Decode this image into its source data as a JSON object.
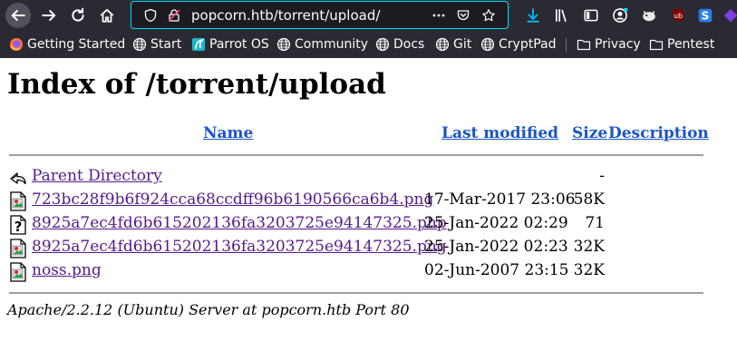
{
  "browser": {
    "url": "popcorn.htb/torrent/upload/",
    "bookmarks": [
      {
        "label": "Getting Started",
        "icon": "firefox-icon"
      },
      {
        "label": "Start",
        "icon": "globe-icon"
      },
      {
        "label": "Parrot OS",
        "icon": "parrot-icon"
      },
      {
        "label": "Community",
        "icon": "globe-icon"
      },
      {
        "label": "Docs",
        "icon": "globe-icon"
      },
      {
        "label": "Git",
        "icon": "globe-icon"
      },
      {
        "label": "CryptPad",
        "icon": "globe-icon"
      },
      {
        "label": "Privacy",
        "icon": "folder-icon"
      },
      {
        "label": "Pentest",
        "icon": "folder-icon"
      }
    ],
    "colors": {
      "chrome": "#2b2a33",
      "urlbar": "#1c1b22",
      "focus": "#00ddff",
      "download": "#00b3f4"
    }
  },
  "page": {
    "title": "Index of /torrent/upload",
    "columns": {
      "name": "Name",
      "modified": "Last modified",
      "size": "Size",
      "description": "Description"
    },
    "rows": [
      {
        "name": "Parent Directory",
        "modified": "",
        "size": "-",
        "icon": "back-icon"
      },
      {
        "name": "723bc28f9b6f924cca68ccdff96b6190566ca6b4.png",
        "modified": "17-Mar-2017 23:06",
        "size": "58K",
        "icon": "image-icon"
      },
      {
        "name": "8925a7ec4fd6b615202136fa3203725e94147325.php",
        "modified": "25-Jan-2022 02:29",
        "size": "71",
        "icon": "unknown-icon"
      },
      {
        "name": "8925a7ec4fd6b615202136fa3203725e94147325.png",
        "modified": "25-Jan-2022 02:23",
        "size": "32K",
        "icon": "image-icon"
      },
      {
        "name": "noss.png",
        "modified": "02-Jun-2007 23:15",
        "size": "32K",
        "icon": "image-icon"
      }
    ],
    "footer": "Apache/2.2.12 (Ubuntu) Server at popcorn.htb Port 80"
  }
}
